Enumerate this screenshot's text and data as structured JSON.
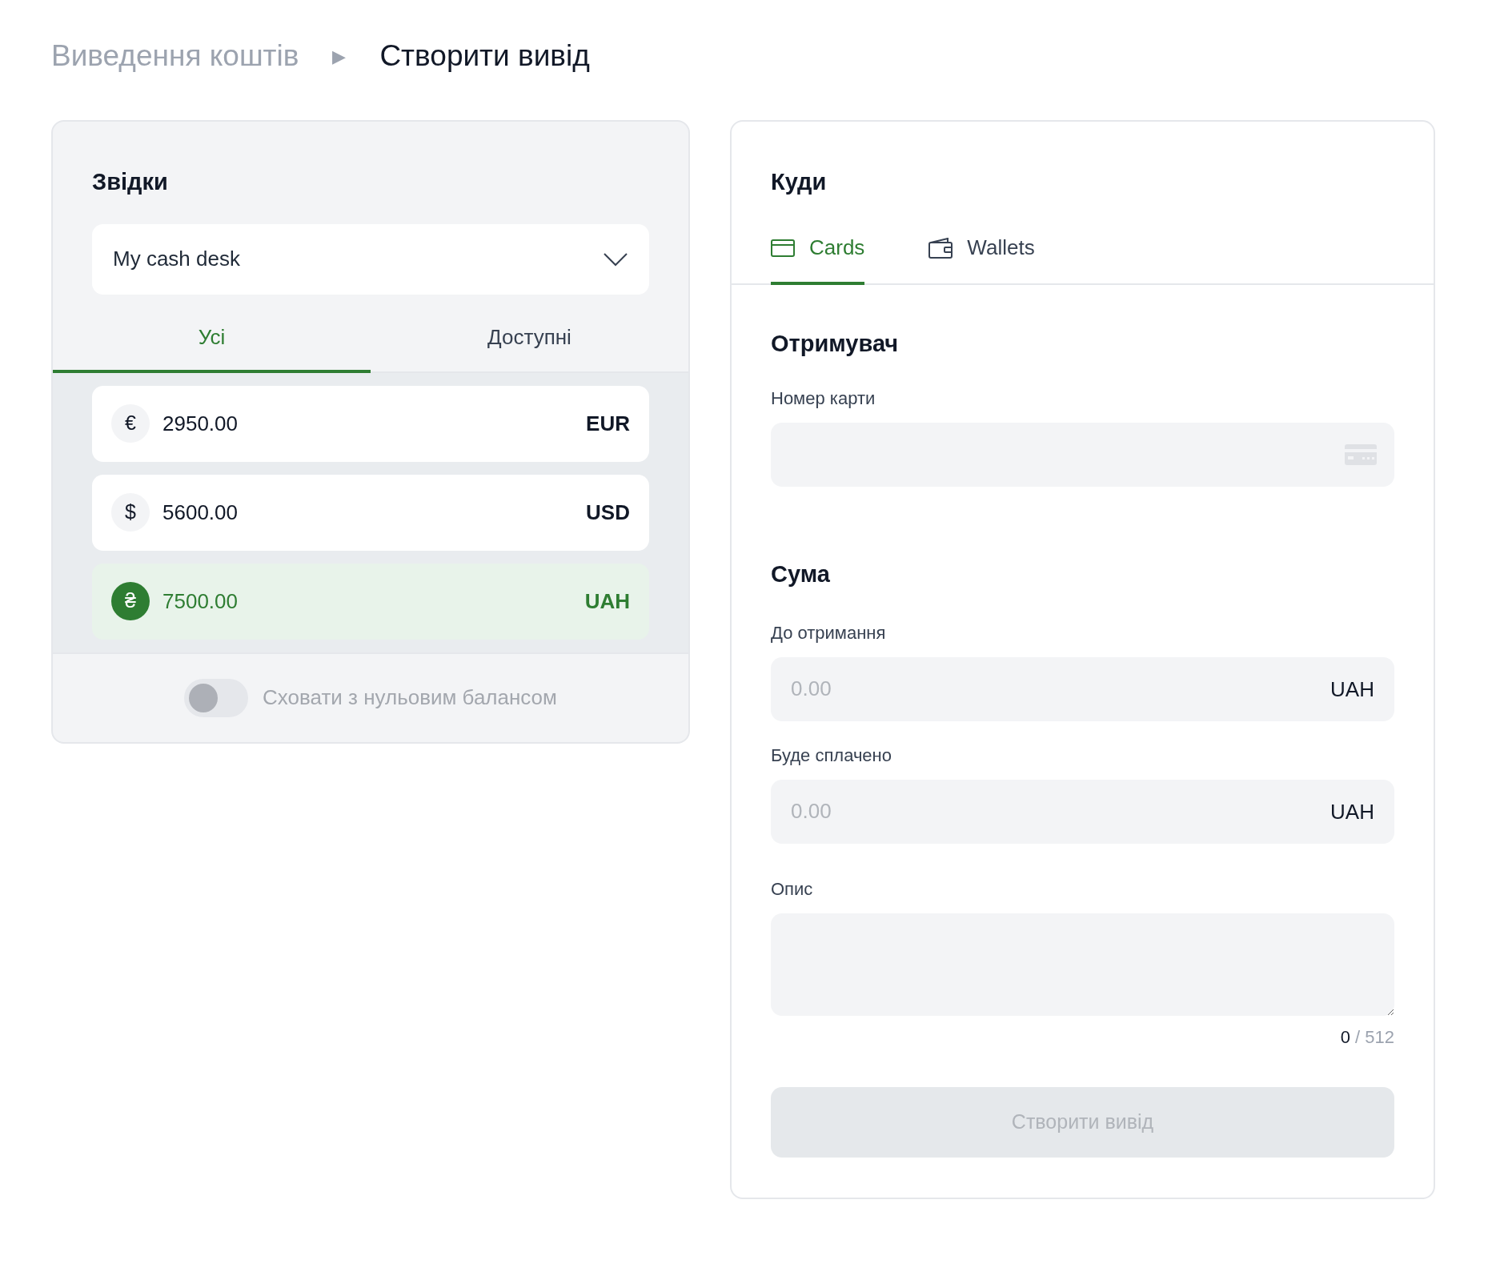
{
  "breadcrumb": [
    {
      "label": "Виведення коштів",
      "current": false
    },
    {
      "label": "Створити вивід",
      "current": true
    }
  ],
  "breadcrumb_separator": "▶",
  "source": {
    "title": "Звідки",
    "select": {
      "value": "My cash desk"
    },
    "tabs": [
      {
        "label": "Усі",
        "selected": true
      },
      {
        "label": "Доступні",
        "selected": false
      }
    ],
    "balances": [
      {
        "symbol": "€",
        "amount": "2950.00",
        "currency": "EUR",
        "selected": false
      },
      {
        "symbol": "$",
        "amount": "5600.00",
        "currency": "USD",
        "selected": false
      },
      {
        "symbol": "₴",
        "amount": "7500.00",
        "currency": "UAH",
        "selected": true
      }
    ],
    "hide_zero_toggle": {
      "label": "Сховати з нульовим балансом",
      "on": false
    }
  },
  "destination": {
    "title": "Куди",
    "tabs": [
      {
        "label": "Cards",
        "kind": "card",
        "selected": true
      },
      {
        "label": "Wallets",
        "kind": "wallet",
        "selected": false
      }
    ],
    "recipient": {
      "heading": "Отримувач",
      "card_number": {
        "label": "Номер карти"
      }
    },
    "amount": {
      "heading": "Сума",
      "fields": [
        {
          "label": "До отримання",
          "placeholder": "0.00",
          "currency": "UAH"
        },
        {
          "label": "Буде сплачено",
          "placeholder": "0.00",
          "currency": "UAH"
        }
      ]
    },
    "description": {
      "label": "Опис",
      "counter": {
        "current": "0",
        "max": "/ 512"
      }
    },
    "submit": {
      "label": "Створити вивід",
      "disabled": true
    }
  }
}
